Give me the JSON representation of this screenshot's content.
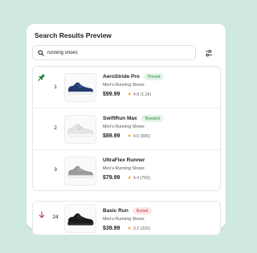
{
  "panel": {
    "title": "Search Results Preview"
  },
  "search": {
    "value": "running shoes",
    "icon": "search-icon"
  },
  "filter": {
    "icon": "sliders-icon"
  },
  "colors": {
    "background": "#cfe9e2",
    "pinned": "#2c8a43",
    "buried": "#c44040",
    "star": "#f2a93b"
  },
  "results": [
    {
      "rank": "1",
      "name": "AeroStride Pro",
      "badge": "Pinned",
      "category": "Men's Running Shoes",
      "price": "$99.99",
      "rating": "4.8",
      "reviews": "(1.2k)",
      "shoe_color": "navy"
    },
    {
      "rank": "2",
      "name": "SwiftRun Max",
      "badge": "Boosted",
      "category": "Men's Running Shoes",
      "price": "$89.99",
      "rating": "4.6",
      "reviews": "(980)",
      "shoe_color": "white"
    },
    {
      "rank": "3",
      "name": "UltraFlex Runner",
      "badge": "",
      "category": "Men's Running Shoes",
      "price": "$79.99",
      "rating": "4.4",
      "reviews": "(760)",
      "shoe_color": "gray"
    }
  ],
  "buried_result": {
    "rank": "24",
    "name": "Basic Run",
    "badge": "Buried",
    "category": "Men's Running Shoes",
    "price": "$39.99",
    "rating": "3.2",
    "reviews": "(320)",
    "shoe_color": "black"
  }
}
